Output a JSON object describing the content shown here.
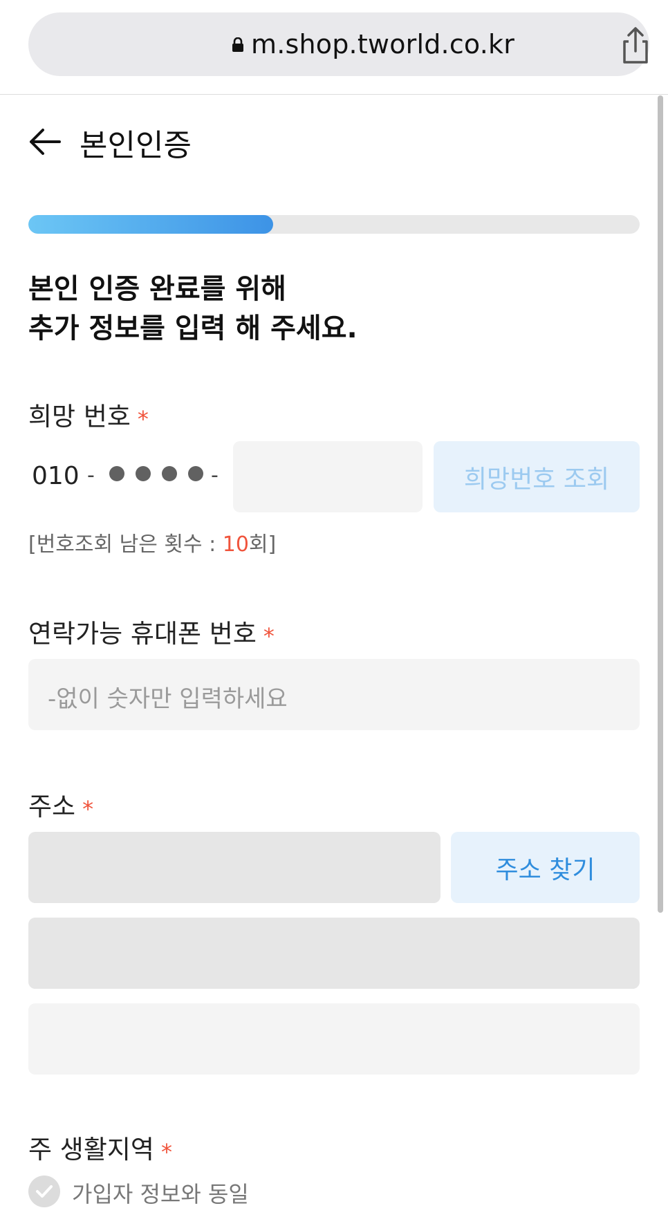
{
  "browser": {
    "url": "m.shop.tworld.co.kr",
    "lock_icon": "lock-icon",
    "share_icon": "share-icon"
  },
  "header": {
    "title": "본인인증",
    "back_icon": "arrow-left-icon"
  },
  "progress": {
    "value_percent": 40
  },
  "main": {
    "heading_line1": "본인 인증 완료를 위해",
    "heading_line2": "추가 정보를 입력 해 주세요."
  },
  "desired_number": {
    "label": "희망 번호",
    "required_mark": "*",
    "prefix": "010",
    "dash": "-",
    "search_button": "희망번호 조회",
    "hint_prefix": "[번호조회 남은 횟수 : ",
    "hint_count": "10",
    "hint_suffix": "회]"
  },
  "contact_phone": {
    "label": "연락가능 휴대폰 번호",
    "required_mark": "*",
    "placeholder": "-없이 숫자만 입력하세요"
  },
  "address": {
    "label": "주소",
    "required_mark": "*",
    "search_button": "주소 찾기"
  },
  "region": {
    "label": "주 생활지역",
    "required_mark": "*",
    "same_as_subscriber": "가입자 정보와 동일"
  },
  "colors": {
    "accent": "#2f8ddd",
    "required": "#f0543c",
    "progress_start": "#6cc6f5",
    "progress_end": "#3d93e6"
  }
}
